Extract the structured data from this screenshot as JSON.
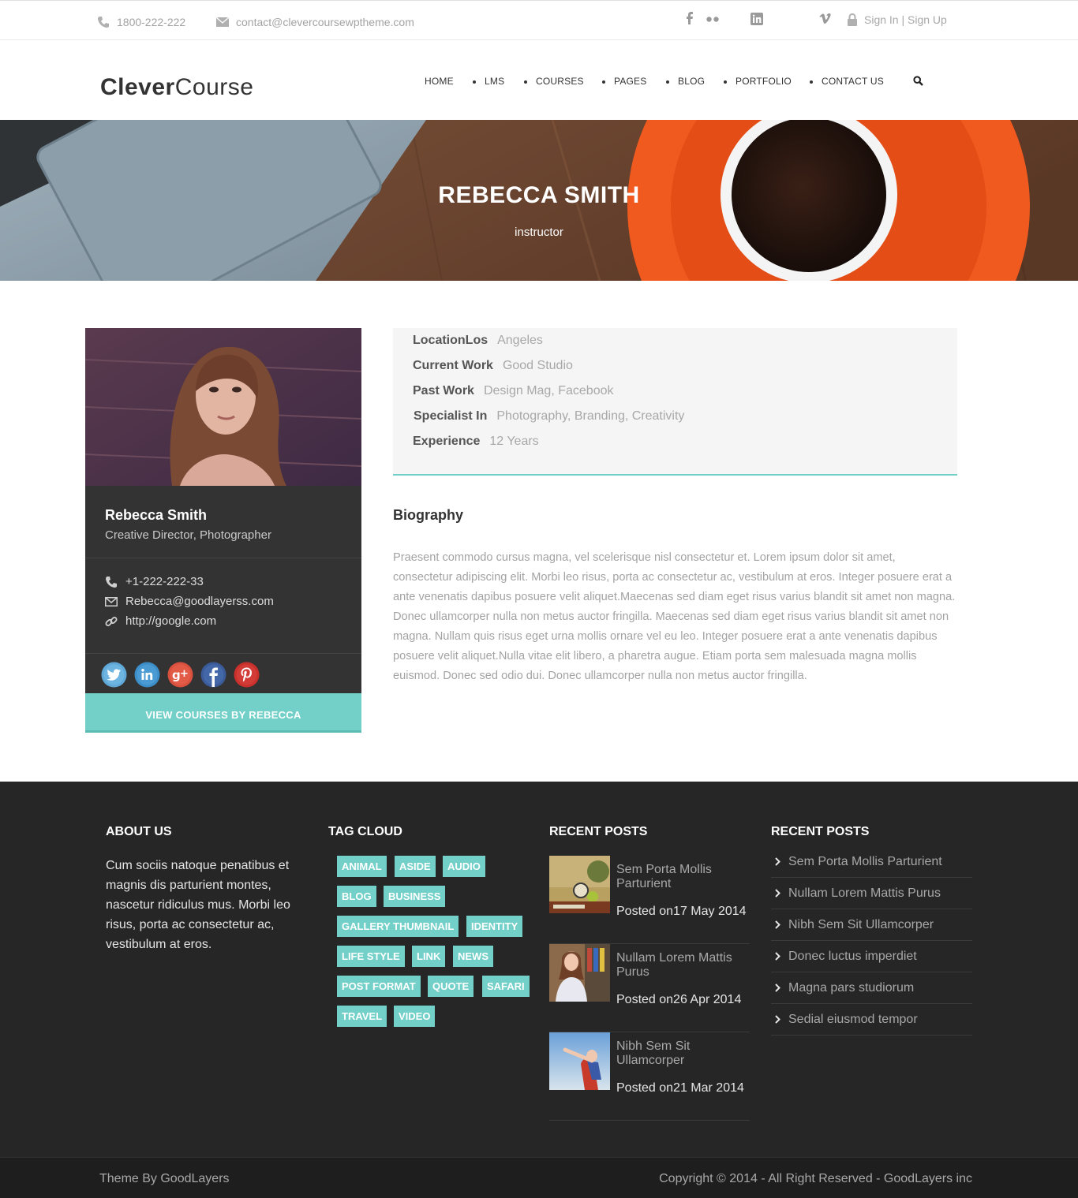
{
  "colors": {
    "accent": "#72d0c8",
    "footer_bg": "#262626",
    "card_bg": "#333333"
  },
  "topbar": {
    "phone": "1800-222-222",
    "email": "contact@clevercoursewptheme.com",
    "social_icons": [
      "facebook-icon",
      "flickr-icon",
      "linkedin-icon",
      "vimeo-icon"
    ],
    "sign_in": "Sign In",
    "separator": " | ",
    "sign_up": "Sign Up"
  },
  "header": {
    "logo_bold": "Clever",
    "logo_light": "Course",
    "nav": [
      {
        "label": "HOME"
      },
      {
        "label": "LMS"
      },
      {
        "label": "COURSES"
      },
      {
        "label": "PAGES"
      },
      {
        "label": "BLOG"
      },
      {
        "label": "PORTFOLIO"
      },
      {
        "label": "CONTACT US"
      }
    ],
    "search_icon": "search-icon"
  },
  "hero": {
    "title": "REBECCA SMITH",
    "subtitle": "instructor"
  },
  "profile": {
    "name": "Rebecca Smith",
    "role": "Creative Director, Photographer",
    "phone": "+1-222-222-33",
    "email": "Rebecca@goodlayerss.com",
    "website": "http://google.com",
    "socials": [
      "twitter-icon",
      "linkedin-icon",
      "google-plus-icon",
      "facebook-icon",
      "pinterest-icon"
    ],
    "view_button": "VIEW COURSES BY REBECCA"
  },
  "details": [
    {
      "label": "LocationLos",
      "value": "Angeles"
    },
    {
      "label": "Current Work",
      "value": "Good Studio"
    },
    {
      "label": "Past Work",
      "value": "Design Mag, Facebook"
    },
    {
      "label": "Specialist In",
      "value": "Photography, Branding, Creativity"
    },
    {
      "label": "Experience",
      "value": "12 Years"
    }
  ],
  "biography": {
    "title": "Biography",
    "text": "Praesent commodo cursus magna, vel scelerisque nisl consectetur et. Lorem ipsum dolor sit amet, consectetur adipiscing elit. Morbi leo risus, porta ac consectetur ac, vestibulum at eros. Integer posuere erat a ante venenatis dapibus posuere velit aliquet.Maecenas sed diam eget risus varius blandit sit amet non magna. Donec ullamcorper nulla non metus auctor fringilla. Maecenas sed diam eget risus varius blandit sit amet non magna. Nullam quis risus eget urna mollis ornare vel eu leo. Integer posuere erat a ante venenatis dapibus posuere velit aliquet.Nulla vitae elit libero, a pharetra augue. Etiam porta sem malesuada magna mollis euismod. Donec sed odio dui. Donec ullamcorper nulla non metus auctor fringilla."
  },
  "footer": {
    "about": {
      "title": "ABOUT US",
      "text": "Cum sociis natoque penatibus et magnis dis parturient montes, nascetur ridiculus mus. Morbi leo risus, porta ac consectetur ac, vestibulum at eros."
    },
    "tag_cloud": {
      "title": "TAG CLOUD",
      "tags": [
        "ANIMAL",
        "ASIDE",
        "AUDIO",
        "BLOG",
        "BUSINESS",
        "GALLERY THUMBNAIL",
        "IDENTITY",
        "LIFE STYLE",
        "LINK",
        "NEWS",
        "POST FORMAT",
        "QUOTE",
        "SAFARI",
        "TRAVEL",
        "VIDEO"
      ]
    },
    "recent_posts": {
      "title": "RECENT POSTS",
      "posts": [
        {
          "title": "Sem Porta Mollis Parturient",
          "date": "Posted on17 May 2014"
        },
        {
          "title": "Nullam Lorem Mattis Purus",
          "date": "Posted on26 Apr 2014"
        },
        {
          "title": "Nibh Sem Sit Ullamcorper",
          "date": "Posted on21 Mar 2014"
        }
      ]
    },
    "recent_list": {
      "title": "RECENT POSTS",
      "items": [
        "Sem Porta Mollis Parturient",
        "Nullam Lorem Mattis Purus",
        "Nibh Sem Sit Ullamcorper",
        "Donec luctus imperdiet",
        "Magna pars studiorum",
        "Sedial eiusmod tempor"
      ]
    }
  },
  "bottom": {
    "left": "Theme By GoodLayers",
    "right": "Copyright © 2014 - All Right Reserved - GoodLayers inc"
  }
}
